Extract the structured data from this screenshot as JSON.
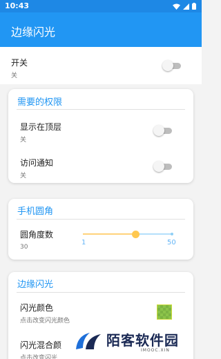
{
  "status_bar": {
    "time": "10:43"
  },
  "app_bar": {
    "title": "边缘闪光"
  },
  "master_switch": {
    "title": "开关",
    "value": "关"
  },
  "permissions": {
    "title": "需要的权限",
    "items": [
      {
        "title": "显示在顶层",
        "value": "关"
      },
      {
        "title": "访问通知",
        "value": "关"
      }
    ]
  },
  "corner": {
    "title": "手机圆角",
    "item": {
      "title": "圆角度数",
      "value": "30"
    },
    "slider": {
      "min_label": "1",
      "max_label": "50",
      "value": 30,
      "min": 1,
      "max": 50
    }
  },
  "edge_flash": {
    "title": "边缘闪光",
    "color": {
      "title": "闪光颜色",
      "subtitle": "点击改变闪光颜色",
      "swatch_color": "#8bc34a"
    },
    "blend": {
      "title": "闪光混合颜",
      "subtitle": "点击改变闪光"
    }
  },
  "watermark": {
    "name": "陌客软件园",
    "sub": "IMOOC.XIN"
  },
  "colors": {
    "primary": "#2196f3",
    "status_bar": "#1e88e5",
    "slider_active": "#ffc850"
  }
}
